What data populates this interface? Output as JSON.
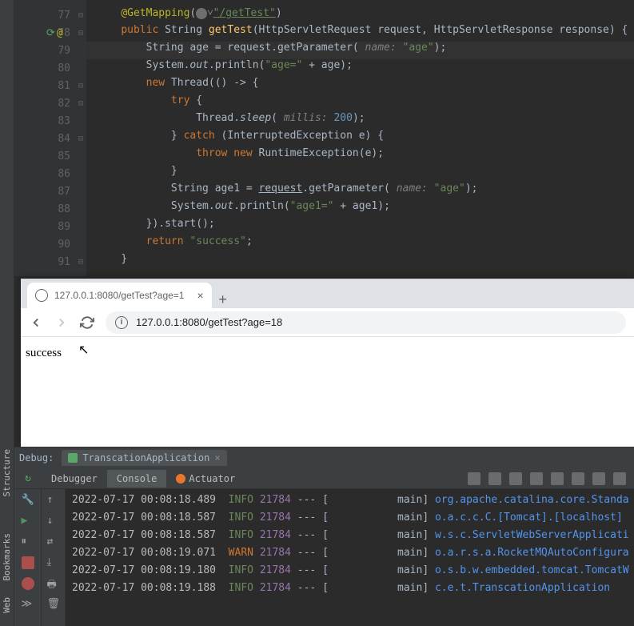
{
  "editor": {
    "lines": [
      {
        "n": 77,
        "fold": "-"
      },
      {
        "n": 78,
        "icons": true,
        "fold": "-"
      },
      {
        "n": 79,
        "hl": true
      },
      {
        "n": 80
      },
      {
        "n": 81,
        "fold": "-"
      },
      {
        "n": 82,
        "fold": "-"
      },
      {
        "n": 83
      },
      {
        "n": 84,
        "fold": "-"
      },
      {
        "n": 85
      },
      {
        "n": 86
      },
      {
        "n": 87
      },
      {
        "n": 88
      },
      {
        "n": 89
      },
      {
        "n": 90
      },
      {
        "n": 91,
        "fold": "-"
      }
    ],
    "tokens": {
      "ann_getmapping": "@GetMapping",
      "ann_url": "\"/getTest\"",
      "kw_public": "public",
      "type_string": "String",
      "m_gettest": "getTest",
      "p_req_t": "HttpServletRequest",
      "p_req": "request",
      "p_res_t": "HttpServletResponse",
      "p_res": "response",
      "age_decl": "String age = request.getParameter(",
      "param_name": " name: ",
      "str_age": "\"age\"",
      "close_call": ");",
      "sys": "System.",
      "out": "out",
      "println": ".println(",
      "str_ageeq": "\"age=\"",
      "plus_age": " + age);",
      "kw_new": "new",
      "thread_lambda": " Thread(() -> {",
      "kw_try": "try",
      "brace_open": " {",
      "thread_sleep": "Thread.",
      "sleep": "sleep",
      "open_paren": "(",
      "param_millis": " millis: ",
      "num_200": "200",
      "brace_close": "}",
      "kw_catch": " catch ",
      "catch_arg": "(InterruptedException e) {",
      "kw_throw": "throw ",
      "runtime_ex": " RuntimeException(e);",
      "age1_decl_a": "String age1 = ",
      "request_u": "request",
      "age1_decl_b": ".getParameter(",
      "str_age1eq": "\"age1=\"",
      "plus_age1": " + age1);",
      "start_call": "}).start();",
      "kw_return": "return ",
      "str_success": "\"success\"",
      "semi": ";",
      "brace_only": "}"
    }
  },
  "browser": {
    "tab_title": "127.0.0.1:8080/getTest?age=1",
    "url": "127.0.0.1:8080/getTest?age=18",
    "content": "success"
  },
  "debug": {
    "label": "Debug:",
    "app_name": "TranscationApplication",
    "tabs": {
      "debugger": "Debugger",
      "console": "Console",
      "actuator": "Actuator"
    },
    "logs": [
      {
        "t": "2022-07-17 00:08:18.489",
        "lvl": "INFO",
        "pid": "21784",
        "mid": " --- [           main] ",
        "cls": "org.apache.catalina.core.Standa"
      },
      {
        "t": "2022-07-17 00:08:18.587",
        "lvl": "INFO",
        "pid": "21784",
        "mid": " --- [           main] ",
        "cls": "o.a.c.c.C.[Tomcat].[localhost]"
      },
      {
        "t": "2022-07-17 00:08:18.587",
        "lvl": "INFO",
        "pid": "21784",
        "mid": " --- [           main] ",
        "cls": "w.s.c.ServletWebServerApplicati"
      },
      {
        "t": "2022-07-17 00:08:19.071",
        "lvl": "WARN",
        "pid": "21784",
        "mid": " --- [           main] ",
        "cls": "o.a.r.s.a.RocketMQAutoConfigura"
      },
      {
        "t": "2022-07-17 00:08:19.180",
        "lvl": "INFO",
        "pid": "21784",
        "mid": " --- [           main] ",
        "cls": "o.s.b.w.embedded.tomcat.TomcatW"
      },
      {
        "t": "2022-07-17 00:08:19.188",
        "lvl": "INFO",
        "pid": "21784",
        "mid": " --- [           main] ",
        "cls": "c.e.t.TranscationApplication"
      }
    ]
  },
  "sidebar": {
    "structure": "Structure",
    "bookmarks": "Bookmarks",
    "web": "Web"
  }
}
